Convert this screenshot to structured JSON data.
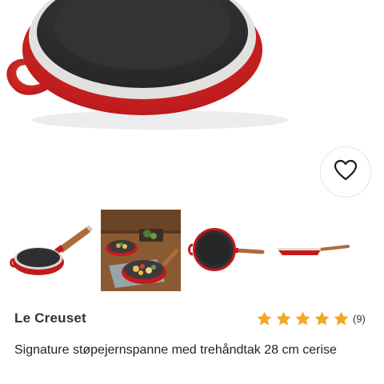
{
  "product": {
    "brand": "Le Creuset",
    "title": "Signature støpejernspanne med trehåndtak 28 cm cerise",
    "rating_value": 5,
    "rating_max": 5,
    "review_count": "(9)"
  },
  "icons": {
    "favorite": "heart-icon",
    "rating": "star-icon"
  },
  "colors": {
    "pan_red": "#c8181b",
    "pan_interior": "#2f2f31",
    "star": "#f5a623",
    "wood": "#b06a3b"
  },
  "gallery": {
    "thumbnails": [
      "pan-side-view",
      "pan-lifestyle-food",
      "pan-top-view",
      "pan-profile-view"
    ]
  }
}
